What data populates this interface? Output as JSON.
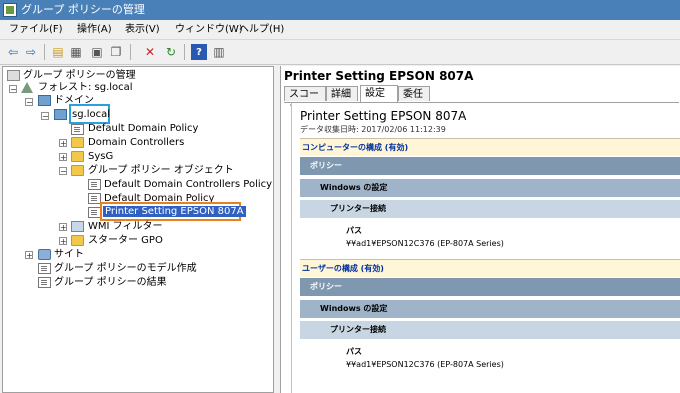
{
  "window": {
    "title": "グループ ポリシーの管理"
  },
  "menu": [
    "ファイル(F)",
    "操作(A)",
    "表示(V)",
    "ウィンドウ(W)",
    "ヘルプ(H)"
  ],
  "toolbar": {
    "icons": [
      "back-arrow-icon",
      "forward-arrow-icon",
      "up-folder-icon",
      "show-pane-icon",
      "properties-icon",
      "copy-icon",
      "delete-icon",
      "refresh-icon",
      "help-icon",
      "console-icon"
    ]
  },
  "tree": {
    "root": "グループ ポリシーの管理",
    "forest": "フォレスト: sg.local",
    "domains": "ドメイン",
    "domain": "sg.local",
    "default_policy": "Default Domain Policy",
    "domain_controllers": "Domain Controllers",
    "sysg": "SysG",
    "gpo_container": "グループ ポリシー オブジェクト",
    "gpo_items": [
      "Default Domain Controllers Policy",
      "Default Domain Policy",
      "Printer Setting EPSON 807A"
    ],
    "wmi_filters": "WMI フィルター",
    "starter_gpo": "スターター GPO",
    "sites": "サイト",
    "modeling": "グループ ポリシーのモデル作成",
    "results": "グループ ポリシーの結果"
  },
  "highlight_colors": {
    "domain": "#2aa0e0",
    "gpo": "#e88020"
  },
  "details": {
    "title": "Printer Setting EPSON 807A",
    "tabs": [
      "スコープ",
      "詳細",
      "設定",
      "委任"
    ],
    "active_tab": "設定",
    "report": {
      "name": "Printer Setting EPSON 807A",
      "collected": "データ収集日時: 2017/02/06 11:12:39",
      "computer_section": "コンピューターの構成 (有効)",
      "user_section": "ユーザーの構成 (有効)",
      "policies": "ポリシー",
      "windows_settings": "Windows の設定",
      "printer_connections": "プリンター接続",
      "path_label": "パス",
      "path_computer": "¥¥ad1¥EPSON12C376 (EP-807A Series)",
      "path_user": "¥¥ad1¥EPSON12C376 (EP-807A Series)"
    }
  }
}
